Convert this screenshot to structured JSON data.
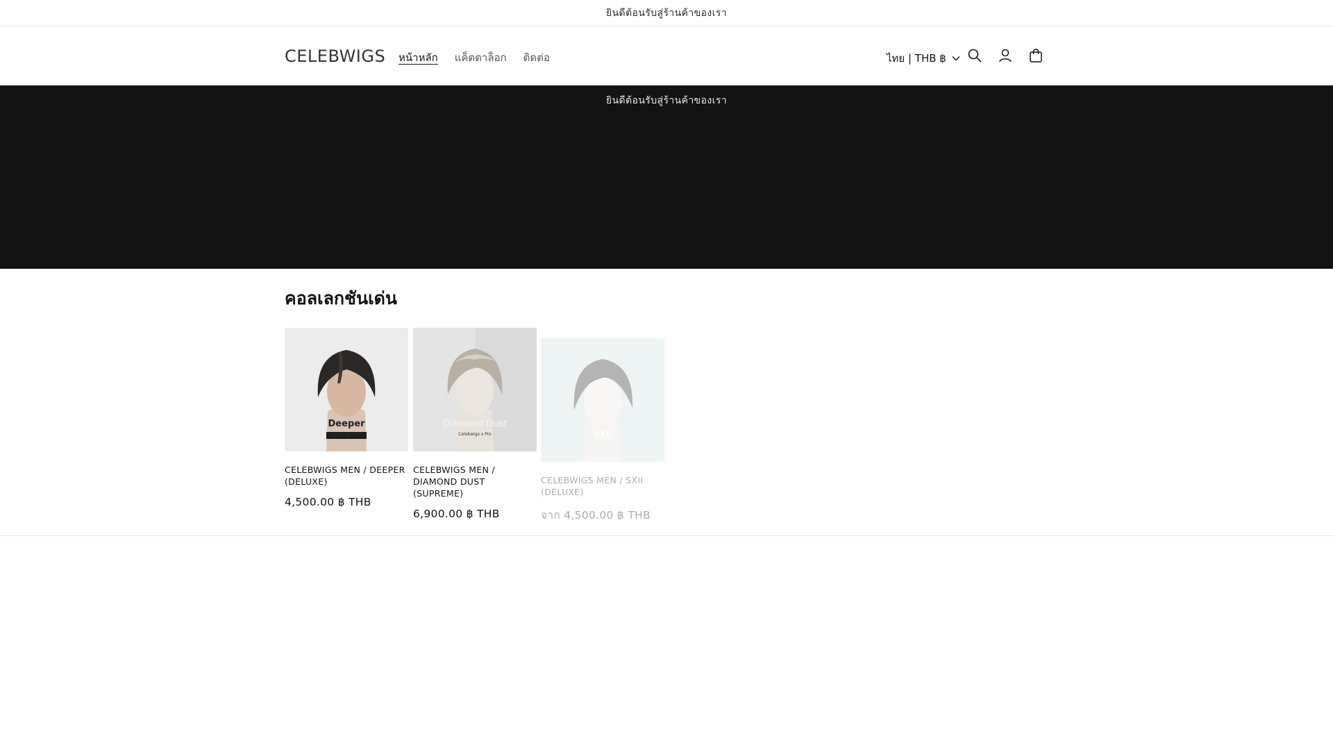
{
  "announcement": {
    "text": "ยินดีต้อนรับสู่ร้านค้าของเรา"
  },
  "header": {
    "logo": "CELEBWIGS",
    "nav": [
      {
        "label": "หน้าหลัก",
        "active": true
      },
      {
        "label": "แค็ตตาล็อก",
        "active": false
      },
      {
        "label": "ติดต่อ",
        "active": false
      }
    ],
    "localization": "ไทย | THB ฿",
    "icons": [
      "search-icon",
      "account-icon",
      "cart-icon"
    ]
  },
  "banner": {
    "text": "ยินดีต้อนรับสู่ร้านค้าของเรา",
    "background": "#131313"
  },
  "collection": {
    "title": "คอลเลกชันเด่น",
    "products": [
      {
        "name": "CELEBWIGS MEN / DEEPER (DELUXE)",
        "price": "4,500.00 ฿ THB",
        "image_label": "Deeper",
        "image_sub": "Celebwigs x Pro"
      },
      {
        "name": "CELEBWIGS MEN / DIAMOND DUST (SUPREME)",
        "price": "6,900.00 ฿ THB",
        "image_label": "Diamond Dust",
        "image_sub": "Celebwigs x Pro"
      },
      {
        "name": "CELEBWIGS MEN / SXII (DELUXE)",
        "price": "จาก 4,500.00 ฿ THB",
        "image_label": "SXII",
        "image_sub": ""
      }
    ]
  }
}
